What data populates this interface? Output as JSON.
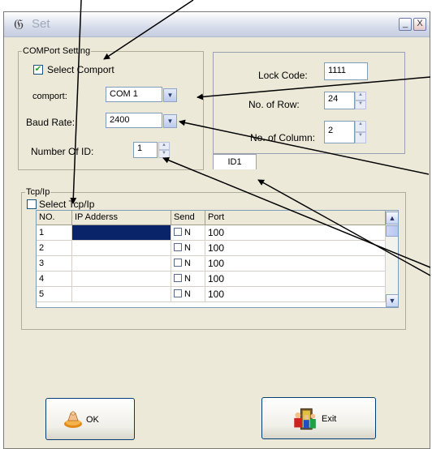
{
  "window": {
    "title": "Set",
    "minimize_glyph": "_",
    "close_glyph": "X",
    "icon": "app-icon"
  },
  "comport_group": {
    "label": "COMPort Setting",
    "select_checkbox": {
      "label": "Select  Comport",
      "checked": true
    },
    "comport_label": "comport:",
    "comport_value": "COM 1",
    "baud_label": "Baud Rate:",
    "baud_value": "2400",
    "number_id_label": "Number Of ID:",
    "number_id_value": "1"
  },
  "lock_group": {
    "lock_code_label": "Lock Code:",
    "lock_code_value": "1111",
    "rows_label": "No. of Row:",
    "rows_value": "24",
    "cols_label": "No. of Column:",
    "cols_value": "2"
  },
  "tab": {
    "label": "ID1"
  },
  "tcp_group": {
    "label": "Tcp/Ip",
    "select_checkbox": {
      "label": "Select  Tcp/Ip",
      "checked": false
    },
    "columns": [
      "NO.",
      "IP Adderss",
      "Send",
      "Port"
    ],
    "rows": [
      {
        "no": "1",
        "ip": "",
        "send": "N",
        "port": "100"
      },
      {
        "no": "2",
        "ip": "",
        "send": "N",
        "port": "100"
      },
      {
        "no": "3",
        "ip": "",
        "send": "N",
        "port": "100"
      },
      {
        "no": "4",
        "ip": "",
        "send": "N",
        "port": "100"
      },
      {
        "no": "5",
        "ip": "",
        "send": "N",
        "port": "100"
      }
    ]
  },
  "buttons": {
    "ok": {
      "label": "OK",
      "icon": "ok-hand-icon"
    },
    "exit": {
      "label": "Exit",
      "icon": "exit-people-icon"
    }
  },
  "colors": {
    "window_bg": "#ece9d8",
    "selection": "#0a246a",
    "check_mark": "#21a121",
    "button_border": "#003c74"
  }
}
